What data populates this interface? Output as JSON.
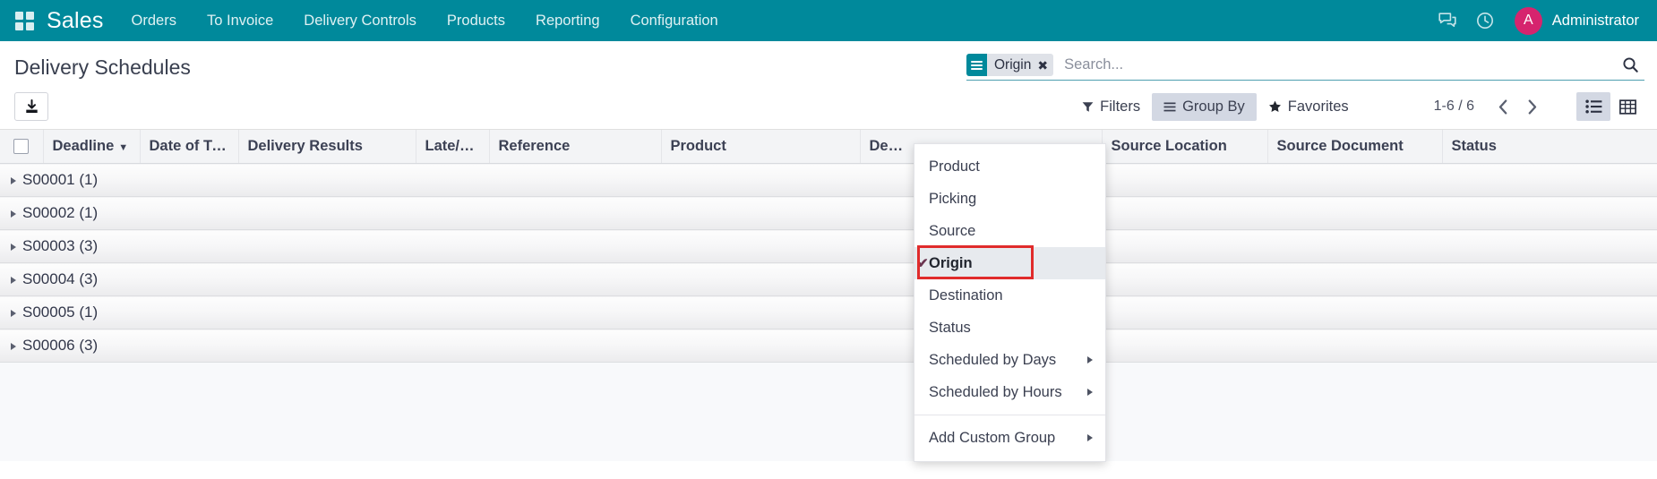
{
  "navbar": {
    "apps_icon": "apps-grid-icon",
    "brand": "Sales",
    "menu": [
      {
        "label": "Orders"
      },
      {
        "label": "To Invoice"
      },
      {
        "label": "Delivery Controls"
      },
      {
        "label": "Products"
      },
      {
        "label": "Reporting"
      },
      {
        "label": "Configuration"
      }
    ],
    "messages_icon": "chat-bubbles-icon",
    "activities_icon": "clock-icon",
    "user": {
      "initial": "A",
      "name": "Administrator",
      "avatar_color": "#d6246e"
    }
  },
  "control_panel": {
    "title": "Delivery Schedules",
    "search": {
      "facet": {
        "icon": "group-by-lines-icon",
        "label": "Origin",
        "close": "✖"
      },
      "placeholder": "Search...",
      "value": "",
      "magnify_icon": "search-icon"
    },
    "export_button_icon": "download-icon",
    "filters_label": "Filters",
    "group_by_label": "Group By",
    "favorites_label": "Favorites",
    "pager": {
      "value": "1-6 / 6",
      "prev_icon": "chevron-left-icon",
      "next_icon": "chevron-right-icon"
    },
    "views": [
      {
        "name": "list",
        "icon": "list-view-icon",
        "active": true
      },
      {
        "name": "pivot",
        "icon": "pivot-view-icon",
        "active": false
      }
    ]
  },
  "table": {
    "columns": [
      {
        "label": "",
        "key": "checkbox"
      },
      {
        "label": "Deadline",
        "sorted": true,
        "sort_caret": "▼"
      },
      {
        "label": "Date of Tra…"
      },
      {
        "label": "Delivery Results"
      },
      {
        "label": "Late/Ea…"
      },
      {
        "label": "Reference"
      },
      {
        "label": "Product"
      },
      {
        "label": "De…"
      },
      {
        "label": "Source Location"
      },
      {
        "label": "Source Document"
      },
      {
        "label": "Status"
      }
    ],
    "groups": [
      {
        "label": "S00001 (1)"
      },
      {
        "label": "S00002 (1)"
      },
      {
        "label": "S00003 (3)"
      },
      {
        "label": "S00004 (3)"
      },
      {
        "label": "S00005 (1)"
      },
      {
        "label": "S00006 (3)"
      }
    ]
  },
  "group_by_dropdown": {
    "items": [
      {
        "label": "Product",
        "selected": false,
        "submenu": false
      },
      {
        "label": "Picking",
        "selected": false,
        "submenu": false
      },
      {
        "label": "Source",
        "selected": false,
        "submenu": false
      },
      {
        "label": "Origin",
        "selected": true,
        "submenu": false,
        "check": "✔",
        "highlighted": true
      },
      {
        "label": "Destination",
        "selected": false,
        "submenu": false
      },
      {
        "label": "Status",
        "selected": false,
        "submenu": false
      },
      {
        "label": "Scheduled by Days",
        "selected": false,
        "submenu": true
      },
      {
        "label": "Scheduled by Hours",
        "selected": false,
        "submenu": true
      }
    ],
    "custom": {
      "label": "Add Custom Group",
      "submenu": true
    }
  },
  "colors": {
    "brand_teal": "#00899b",
    "avatar_pink": "#d6246e",
    "annotation_red": "#e02b2b",
    "active_button": "#d3d8e3"
  }
}
